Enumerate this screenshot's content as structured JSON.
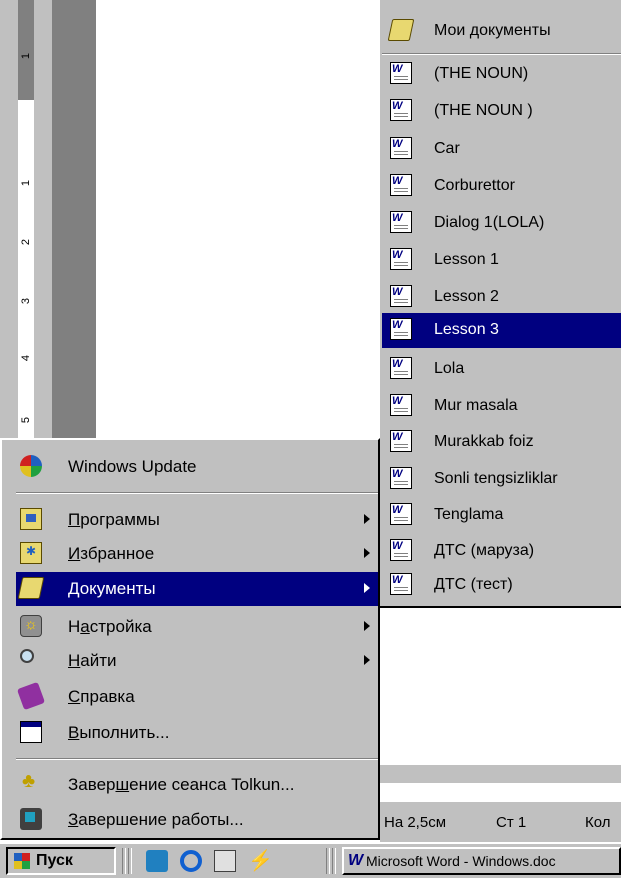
{
  "start_menu": {
    "windows_update": "Windows Update",
    "items": [
      {
        "pre": "",
        "ul": "П",
        "post": "рограммы"
      },
      {
        "pre": "",
        "ul": "И",
        "post": "збранное"
      },
      {
        "pre": "",
        "ul": "Д",
        "post": "окументы"
      },
      {
        "pre": "Н",
        "ul": "а",
        "post": "стройка"
      },
      {
        "pre": "",
        "ul": "Н",
        "post": "айти"
      },
      {
        "pre": "",
        "ul": "С",
        "post": "правка"
      },
      {
        "pre": "",
        "ul": "В",
        "post": "ыполнить..."
      }
    ],
    "logoff": {
      "pre": "Завер",
      "ul": "ш",
      "post": "ение сеанса Tolkun..."
    },
    "shutdown": {
      "pre": "",
      "ul": "З",
      "post": "авершение работы..."
    }
  },
  "documents_submenu": {
    "my_documents": "Мои документы",
    "files": [
      "(THE  NOUN)",
      "(THE NOUN )",
      "Car",
      "Corburettor",
      "Dialog 1(LOLA)",
      "Lesson 1",
      "Lesson 2",
      "Lesson 3",
      "Lola",
      "Mur masala",
      "Murakkab foiz",
      "Sonli tengsizliklar",
      "Tenglama",
      "ДТС (маруза)",
      "ДТС (тест)"
    ],
    "selected": "Lesson 3"
  },
  "word_status": {
    "position": "На 2,5см",
    "line": "Ст 1",
    "column": "Кол"
  },
  "ruler": {
    "numbers": [
      "1",
      "1",
      "2",
      "3",
      "4",
      "5"
    ]
  },
  "taskbar": {
    "start_label": "Пуск",
    "word_task": "Microsoft Word - Windows.doc"
  }
}
